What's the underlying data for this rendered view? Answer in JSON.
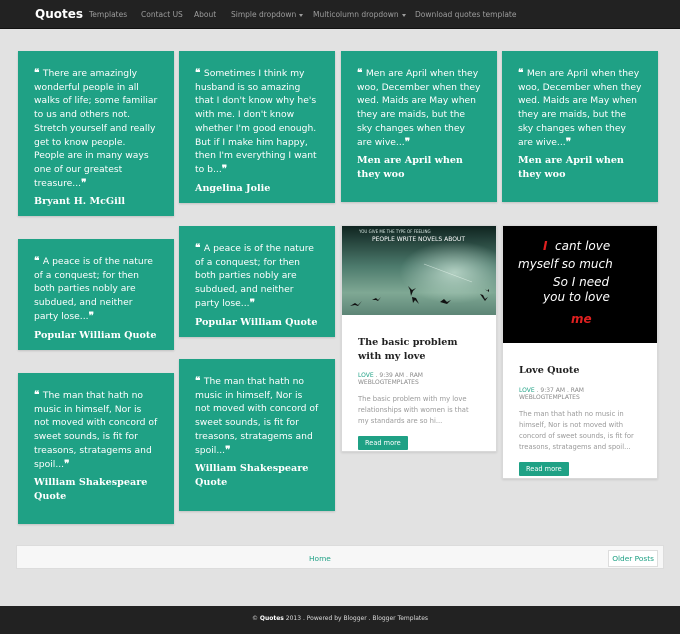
{
  "nav": {
    "brand": "Quotes",
    "items": [
      {
        "label": "Templates"
      },
      {
        "label": "Contact US"
      },
      {
        "label": "About"
      },
      {
        "label": "Simple dropdown"
      },
      {
        "label": "Multicolumn dropdown"
      },
      {
        "label": "Download quotes template"
      }
    ]
  },
  "quotes": [
    {
      "text": "There are amazingly wonderful people in all walks of life; some familiar to us and others not. Stretch yourself and really get to know people. People are in many ways one of our greatest treasure...",
      "author": "Bryant H. McGill"
    },
    {
      "text": "Sometimes I think my husband is so amazing that I don't know why he's with me. I don't know whether I'm good enough. But if I make him happy, then I'm everything I want to b...",
      "author": "Angelina Jolie"
    },
    {
      "text": "Men are April when they woo, December when they wed. Maids are May when they are maids, but the sky changes when they are wive...",
      "author": "Men are April when they woo"
    },
    {
      "text": "Men are April when they woo, December when they wed. Maids are May when they are maids, but the sky changes when they are wive...",
      "author": "Men are April when they woo"
    },
    {
      "text": "A peace is of the nature of a conquest; for then both parties nobly are subdued, and neither party lose...",
      "author": "Popular William Quote"
    },
    {
      "text": "A peace is of the nature of a conquest; for then both parties nobly are subdued, and neither party lose...",
      "author": "Popular William Quote"
    },
    {
      "text": "The man that hath no music in himself, Nor is not moved with concord of sweet sounds, is fit for treasons, stratagems and spoil...",
      "author": "William Shakespeare Quote"
    },
    {
      "text": "The man that hath no music in himself, Nor is not moved with concord of sweet sounds, is fit for treasons, stratagems and spoil...",
      "author": "William Shakespeare Quote"
    }
  ],
  "posts": [
    {
      "image_top": "YOU GIVE ME THE TYPE OF FEELING",
      "image_main": "PEOPLE WRITE NOVELS ABOUT",
      "title": "The basic problem with my love",
      "label": "LOVE",
      "meta": " . 9:39 AM . RAM WEBLOGTEMPLATES",
      "excerpt": "The basic problem with my love relationships with women is that my standards are so hi...",
      "button": "Read more"
    },
    {
      "image_line1": "I",
      "image_line1b": "cant love",
      "image_line2": "myself so much",
      "image_line3": "So I need",
      "image_line4": "you to love",
      "image_line5": "me",
      "title": "Love Quote",
      "label": "LOVE",
      "meta": " . 9:37 AM . RAM WEBLOGTEMPLATES",
      "excerpt": "The man that hath no music in himself, Nor is not moved with concord of sweet sounds, is fit for treasons, stratagems and spoil...",
      "button": "Read more"
    }
  ],
  "pager": {
    "home": "Home",
    "older": "Older Posts"
  },
  "footer": {
    "copyright": "© ",
    "brand": "Quotes",
    "rest": " 2013 . Powered by Blogger . Blogger Templates"
  },
  "colors": {
    "accent": "#1fa185",
    "navbar": "#222222"
  }
}
